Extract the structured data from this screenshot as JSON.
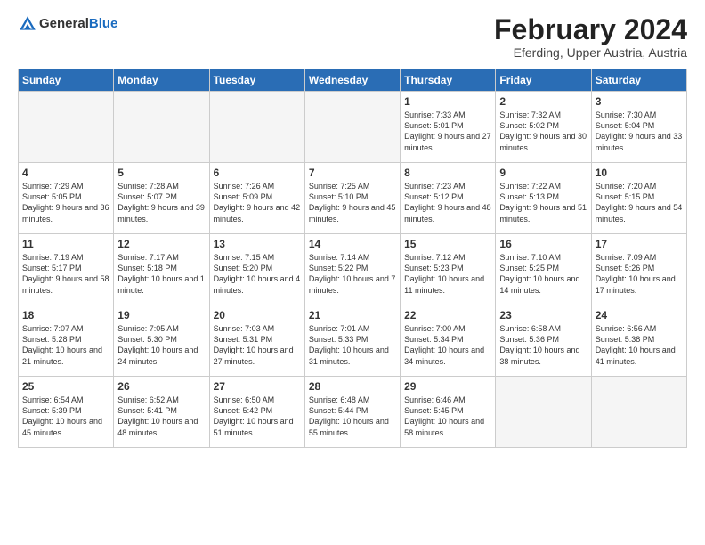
{
  "logo": {
    "line1": "General",
    "line2": "Blue"
  },
  "title": "February 2024",
  "subtitle": "Eferding, Upper Austria, Austria",
  "weekdays": [
    "Sunday",
    "Monday",
    "Tuesday",
    "Wednesday",
    "Thursday",
    "Friday",
    "Saturday"
  ],
  "weeks": [
    [
      {
        "day": "",
        "info": ""
      },
      {
        "day": "",
        "info": ""
      },
      {
        "day": "",
        "info": ""
      },
      {
        "day": "",
        "info": ""
      },
      {
        "day": "1",
        "info": "Sunrise: 7:33 AM\nSunset: 5:01 PM\nDaylight: 9 hours\nand 27 minutes."
      },
      {
        "day": "2",
        "info": "Sunrise: 7:32 AM\nSunset: 5:02 PM\nDaylight: 9 hours\nand 30 minutes."
      },
      {
        "day": "3",
        "info": "Sunrise: 7:30 AM\nSunset: 5:04 PM\nDaylight: 9 hours\nand 33 minutes."
      }
    ],
    [
      {
        "day": "4",
        "info": "Sunrise: 7:29 AM\nSunset: 5:05 PM\nDaylight: 9 hours\nand 36 minutes."
      },
      {
        "day": "5",
        "info": "Sunrise: 7:28 AM\nSunset: 5:07 PM\nDaylight: 9 hours\nand 39 minutes."
      },
      {
        "day": "6",
        "info": "Sunrise: 7:26 AM\nSunset: 5:09 PM\nDaylight: 9 hours\nand 42 minutes."
      },
      {
        "day": "7",
        "info": "Sunrise: 7:25 AM\nSunset: 5:10 PM\nDaylight: 9 hours\nand 45 minutes."
      },
      {
        "day": "8",
        "info": "Sunrise: 7:23 AM\nSunset: 5:12 PM\nDaylight: 9 hours\nand 48 minutes."
      },
      {
        "day": "9",
        "info": "Sunrise: 7:22 AM\nSunset: 5:13 PM\nDaylight: 9 hours\nand 51 minutes."
      },
      {
        "day": "10",
        "info": "Sunrise: 7:20 AM\nSunset: 5:15 PM\nDaylight: 9 hours\nand 54 minutes."
      }
    ],
    [
      {
        "day": "11",
        "info": "Sunrise: 7:19 AM\nSunset: 5:17 PM\nDaylight: 9 hours\nand 58 minutes."
      },
      {
        "day": "12",
        "info": "Sunrise: 7:17 AM\nSunset: 5:18 PM\nDaylight: 10 hours\nand 1 minute."
      },
      {
        "day": "13",
        "info": "Sunrise: 7:15 AM\nSunset: 5:20 PM\nDaylight: 10 hours\nand 4 minutes."
      },
      {
        "day": "14",
        "info": "Sunrise: 7:14 AM\nSunset: 5:22 PM\nDaylight: 10 hours\nand 7 minutes."
      },
      {
        "day": "15",
        "info": "Sunrise: 7:12 AM\nSunset: 5:23 PM\nDaylight: 10 hours\nand 11 minutes."
      },
      {
        "day": "16",
        "info": "Sunrise: 7:10 AM\nSunset: 5:25 PM\nDaylight: 10 hours\nand 14 minutes."
      },
      {
        "day": "17",
        "info": "Sunrise: 7:09 AM\nSunset: 5:26 PM\nDaylight: 10 hours\nand 17 minutes."
      }
    ],
    [
      {
        "day": "18",
        "info": "Sunrise: 7:07 AM\nSunset: 5:28 PM\nDaylight: 10 hours\nand 21 minutes."
      },
      {
        "day": "19",
        "info": "Sunrise: 7:05 AM\nSunset: 5:30 PM\nDaylight: 10 hours\nand 24 minutes."
      },
      {
        "day": "20",
        "info": "Sunrise: 7:03 AM\nSunset: 5:31 PM\nDaylight: 10 hours\nand 27 minutes."
      },
      {
        "day": "21",
        "info": "Sunrise: 7:01 AM\nSunset: 5:33 PM\nDaylight: 10 hours\nand 31 minutes."
      },
      {
        "day": "22",
        "info": "Sunrise: 7:00 AM\nSunset: 5:34 PM\nDaylight: 10 hours\nand 34 minutes."
      },
      {
        "day": "23",
        "info": "Sunrise: 6:58 AM\nSunset: 5:36 PM\nDaylight: 10 hours\nand 38 minutes."
      },
      {
        "day": "24",
        "info": "Sunrise: 6:56 AM\nSunset: 5:38 PM\nDaylight: 10 hours\nand 41 minutes."
      }
    ],
    [
      {
        "day": "25",
        "info": "Sunrise: 6:54 AM\nSunset: 5:39 PM\nDaylight: 10 hours\nand 45 minutes."
      },
      {
        "day": "26",
        "info": "Sunrise: 6:52 AM\nSunset: 5:41 PM\nDaylight: 10 hours\nand 48 minutes."
      },
      {
        "day": "27",
        "info": "Sunrise: 6:50 AM\nSunset: 5:42 PM\nDaylight: 10 hours\nand 51 minutes."
      },
      {
        "day": "28",
        "info": "Sunrise: 6:48 AM\nSunset: 5:44 PM\nDaylight: 10 hours\nand 55 minutes."
      },
      {
        "day": "29",
        "info": "Sunrise: 6:46 AM\nSunset: 5:45 PM\nDaylight: 10 hours\nand 58 minutes."
      },
      {
        "day": "",
        "info": ""
      },
      {
        "day": "",
        "info": ""
      }
    ]
  ]
}
